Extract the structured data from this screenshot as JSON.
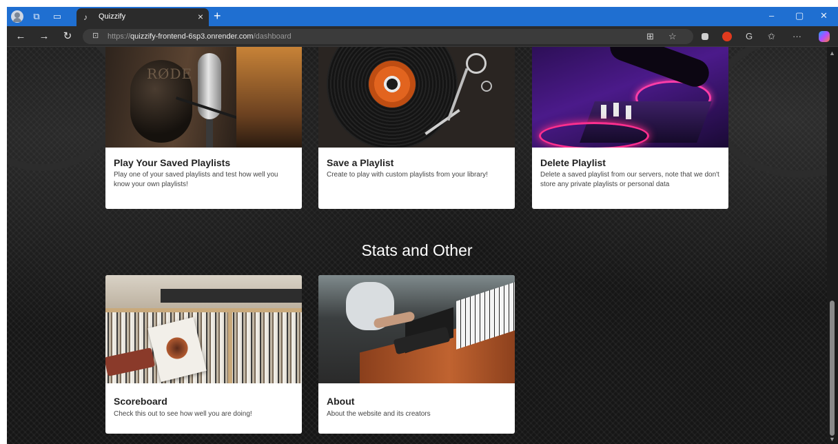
{
  "browser": {
    "tab_title": "Quizzify",
    "url_prefix": "https://",
    "url_host": "quizzify-frontend-6sp3.onrender.com",
    "url_path": "/dashboard",
    "icons": {
      "back": "←",
      "forward": "→",
      "reload": "↻",
      "lock": "🔒",
      "close_tab": "×",
      "new_tab": "+",
      "minimize": "–",
      "maximize": "▢",
      "close_window": "✕",
      "more": "···"
    }
  },
  "cards_top": [
    {
      "title": "Play Your Saved Playlists",
      "description": "Play one of your saved playlists and test how well you know your own playlists!",
      "image": "microphone-photo"
    },
    {
      "title": "Save a Playlist",
      "description": "Create to play with custom playlists from your library!",
      "image": "turntable-photo"
    },
    {
      "title": "Delete Playlist",
      "description": "Delete a saved playlist from our servers, note that we don't store any private playlists or personal data",
      "image": "dj-controller-photo"
    }
  ],
  "section_title": "Stats and Other",
  "cards_bottom": [
    {
      "title": "Scoreboard",
      "description": "Check this out to see how well you are doing!",
      "image": "vinyl-shelf-photo"
    },
    {
      "title": "About",
      "description": "About the website and its creators",
      "image": "studio-desk-photo"
    }
  ],
  "mic_brand_text": "RØDE",
  "colors": {
    "tab_bar": "#1f6fd1",
    "page_bg": "#161616",
    "card_bg": "#ffffff"
  }
}
